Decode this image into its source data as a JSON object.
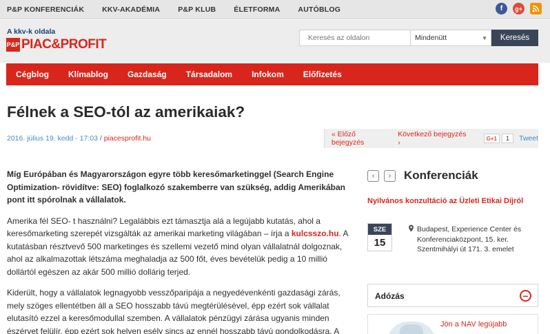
{
  "topbar": {
    "links": [
      "P&P KONFERENCIÁK",
      "KKV-AKADÉMIA",
      "P&P KLUB",
      "ÉLETFORMA",
      "AUTÓBLOG"
    ],
    "social": {
      "facebook": "f",
      "googleplus": "g+",
      "rss": "rss-icon"
    }
  },
  "header": {
    "tagline": "A kkv-k oldala",
    "logo_mark": "P&P",
    "logo_text": "PIAC&PROFIT",
    "search_placeholder": "Keresés az oldalon",
    "search_scope": "Mindenütt",
    "search_button": "Keresés"
  },
  "mainnav": [
    "Cégblog",
    "Klímablog",
    "Gazdaság",
    "Társadalom",
    "Infokom",
    "Előfizetés"
  ],
  "article": {
    "title": "Félnek a SEO-tól az amerikaiak?",
    "date": "2016. július 19. kedd - 17:03",
    "separator": "/",
    "source": "piacesprofit.hu",
    "prev": "« Előző bejegyzés",
    "next": "Következő bejegyzés ›",
    "gplus_label": "G+1",
    "gplus_count": "1",
    "tweet": "Tweet",
    "lead": "Míg Európában és Magyarországon egyre több keresőmarketinggel (Search Engine Optimization- rövidítve: SEO) foglalkozó szakemberre van szükség, addig Amerikában pont itt spórolnak a vállalatok.",
    "p1_a": "Amerika fél SEO- t használni? Legalábbis ezt támasztja alá a legújabb kutatás, ahol a keresőmarketing szerepét vizsgálták az amerikai marketing világában – írja a ",
    "p1_link": "kulcsszo.hu",
    "p1_b": ". A kutatásban résztvevő 500 marketinges és szellemi vezető mind olyan vállalatnál dolgoznak, ahol az alkalmazottak létszáma meghaladja az 500 főt, éves bevételük pedig a 10 millió dollártól egészen az akár 500 millió dollárig terjed.",
    "p2": "Kiderült, hogy a vállalatok legnagyobb vesszőparipája a negyedévenkénti gazdasági zárás, mely szöges ellentétben áll a SEO hosszabb távú megtérülésével, épp ezért sok vállalat elutasító ezzel a keresőmodullal szemben. A vállalatok pénzügyi zárása ugyanis minden észérvet felülír, épp ezért sok helyen esély sincs az ennél hosszabb távú gondolkodásra. A"
  },
  "sidebar": {
    "prev_arrow": "‹",
    "next_arrow": "›",
    "title": "Konferenciák",
    "event_title": "Nyilvános konzultáció az Üzleti Etikai Díjról",
    "event_month": "SZE",
    "event_day": "15",
    "event_location": "Budapest, Experience Center és Konferenciaközpont, 15. ker. Szentmihályi út 171. 3. emelet",
    "accordion_label": "Adózás",
    "accordion_toggle": "−",
    "teaser_text": "Jön a NAV legújabb"
  },
  "colors": {
    "brand_red": "#d9261c",
    "dark_navy": "#3a4558",
    "link_blue": "#4a8ac4"
  }
}
